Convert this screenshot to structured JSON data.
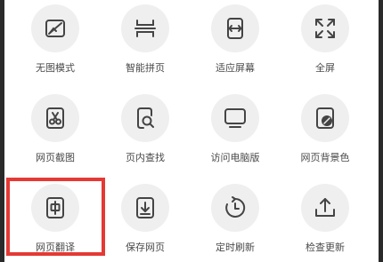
{
  "menu": {
    "rows": [
      [
        {
          "label": "无图模式",
          "icon": "no-image-icon"
        },
        {
          "label": "智能拼页",
          "icon": "smart-page-merge-icon"
        },
        {
          "label": "适应屏幕",
          "icon": "fit-screen-icon"
        },
        {
          "label": "全屏",
          "icon": "fullscreen-icon"
        }
      ],
      [
        {
          "label": "网页截图",
          "icon": "screenshot-icon"
        },
        {
          "label": "页内查找",
          "icon": "find-in-page-icon"
        },
        {
          "label": "访问电脑版",
          "icon": "desktop-version-icon"
        },
        {
          "label": "网页背景色",
          "icon": "background-color-icon"
        }
      ],
      [
        {
          "label": "网页翻译",
          "icon": "translate-icon"
        },
        {
          "label": "保存网页",
          "icon": "save-page-icon"
        },
        {
          "label": "定时刷新",
          "icon": "timed-refresh-icon"
        },
        {
          "label": "检查更新",
          "icon": "check-update-icon"
        }
      ]
    ]
  },
  "colors": {
    "highlight": "#e53935",
    "icon_stroke": "#444444",
    "circle_bg": "#efefef"
  }
}
